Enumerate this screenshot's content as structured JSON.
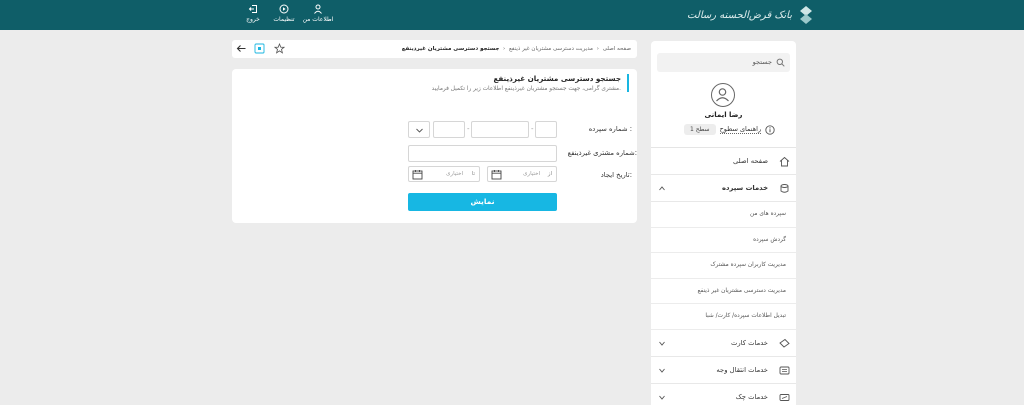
{
  "topbar": {
    "logo_text": "بانک قرض‌الحسنه رسالت",
    "items": [
      {
        "label": "اطلاعات من",
        "icon": "user-icon"
      },
      {
        "label": "تنظیمات",
        "icon": "settings-icon"
      },
      {
        "label": "خروج",
        "icon": "logout-icon"
      }
    ]
  },
  "sidebar": {
    "search_placeholder": "جستجو",
    "user_name": "رضا ایمانی",
    "guide_label": "راهنمای سطوح",
    "level_badge": "سطح 1",
    "menu": [
      {
        "label": "صفحه اصلی",
        "icon": "home-icon"
      },
      {
        "label": "خدمات سپرده",
        "icon": "deposit-icon",
        "expanded": true
      },
      {
        "label": "خدمات کارت",
        "icon": "card-icon"
      },
      {
        "label": "خدمات انتقال وجه",
        "icon": "transfer-icon"
      },
      {
        "label": "خدمات چک",
        "icon": "cheque-icon"
      }
    ],
    "submenu": [
      "سپرده های من",
      "گردش سپرده",
      "مدیریت کاربران سپرده مشترک",
      "مدیریت دسترسی مشتریان غیر ذینفع",
      "تبدیل اطلاعات سپرده/ کارت/ شبا"
    ]
  },
  "breadcrumb": {
    "items": [
      "صفحه اصلی",
      "مدیریت دسترسی مشتریان غیر ذینفع",
      "جستجو دسترسی مشتریان غیرذینفع"
    ]
  },
  "form": {
    "title": "جستجو دسترسی مشتریان غیرذینفع",
    "subtitle": "مشتری گرامی، جهت جستجو مشتریان غیرذینفع اطلاعات زیر را تکمیل فرمایید.",
    "deposit_label": "شماره سپرده :",
    "customer_label": "شماره مشتری غیرذینفع:",
    "date_label": "تاریخ ایجاد:",
    "date_from_prefix": "از",
    "date_to_prefix": "تا",
    "date_placeholder": "اختیاری",
    "submit_label": "نمایش"
  },
  "colors": {
    "topbar": "#0f5e68",
    "accent": "#17b7e3"
  }
}
